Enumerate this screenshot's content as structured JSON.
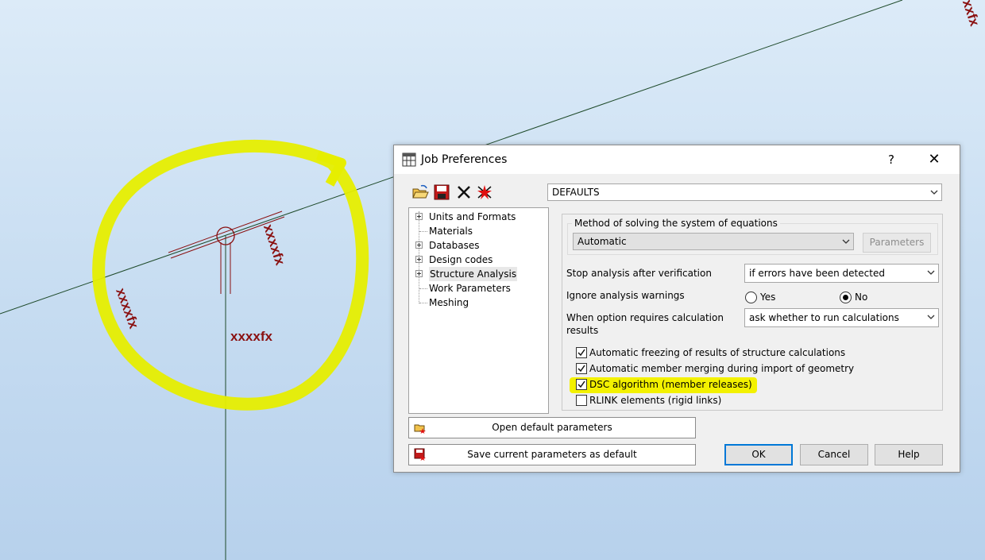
{
  "canvas": {
    "labels": [
      "xxxxfx",
      "xxxxfx",
      "xxxxfx",
      "xxfx"
    ],
    "colors": {
      "background": "#c6dcf1",
      "label": "#8a1010",
      "line": "#1e4a2a",
      "highlight": "#e6ee00"
    }
  },
  "dialog": {
    "title": "Job Preferences",
    "help_glyph": "?",
    "close_glyph": "✕",
    "toolbar": {
      "icons": [
        "open-folder-icon",
        "save-disk-icon",
        "delete-x-icon",
        "reset-star-icon"
      ]
    },
    "preset": {
      "value": "DEFAULTS"
    },
    "tree": {
      "items": [
        {
          "label": "Units and Formats",
          "expandable": true
        },
        {
          "label": "Materials",
          "expandable": false
        },
        {
          "label": "Databases",
          "expandable": true
        },
        {
          "label": "Design codes",
          "expandable": true
        },
        {
          "label": "Structure Analysis",
          "expandable": true,
          "selected": true
        },
        {
          "label": "Work Parameters",
          "expandable": false
        },
        {
          "label": "Meshing",
          "expandable": false
        }
      ]
    },
    "method": {
      "group_title": "Method of solving the system of equations",
      "value": "Automatic",
      "parameters_label": "Parameters"
    },
    "stop_analysis": {
      "label": "Stop analysis after verification",
      "value": "if errors have been detected"
    },
    "ignore_warnings": {
      "label": "Ignore analysis warnings",
      "yes_label": "Yes",
      "no_label": "No",
      "selected": "No"
    },
    "when_option": {
      "label_line1": "When option requires calculation",
      "label_line2": "results",
      "value": "ask whether to run calculations"
    },
    "checkboxes": [
      {
        "label": "Automatic freezing of results of structure calculations",
        "checked": true
      },
      {
        "label": "Automatic member merging during import of geometry",
        "checked": true
      },
      {
        "label": "DSC algorithm (member releases)",
        "checked": true,
        "highlighted": true
      },
      {
        "label": "RLINK elements (rigid links)",
        "checked": false
      }
    ],
    "buttons": {
      "open_default": "Open default parameters",
      "save_default": "Save current parameters as default",
      "ok": "OK",
      "cancel": "Cancel",
      "help": "Help"
    }
  }
}
